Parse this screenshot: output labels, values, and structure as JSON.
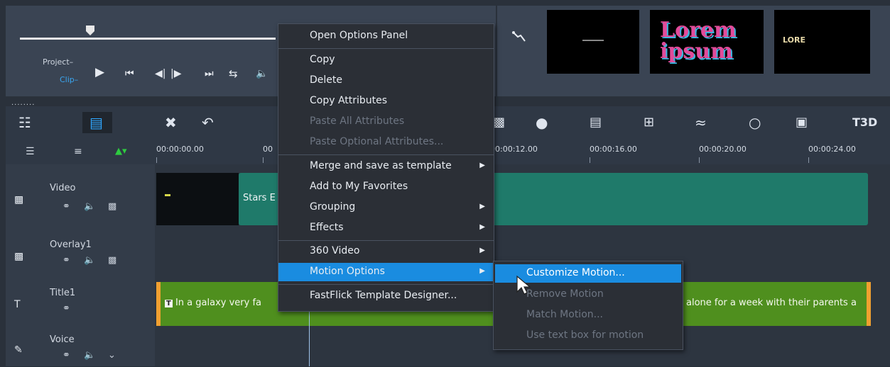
{
  "player": {
    "project_label": "Project–",
    "clip_label": "Clip–",
    "controls": [
      "▶",
      "|◀",
      "◀|",
      "|▶",
      "▶|",
      "⇄",
      "◀)"
    ]
  },
  "thumbnails": {
    "thumb2_text": "Lorem ipsum",
    "thumb3_text": "LORE"
  },
  "toolbar": {
    "dots": "........",
    "icons": [
      "film-strip-icon",
      "timeline-icon",
      "tools-icon",
      "undo-icon",
      "motion-tracking-icon",
      "mask-icon",
      "title-icon",
      "split-screen-icon",
      "speed-icon",
      "shape-icon",
      "fit-icon",
      "3d-title-icon"
    ],
    "title_3d_label": "T3D"
  },
  "ruler": {
    "ticks": [
      "00:00:00.00",
      "00",
      "00:00:12.00",
      "00:00:16.00",
      "00:00:20.00",
      "00:00:24.00"
    ]
  },
  "tracks": [
    {
      "name": "Video"
    },
    {
      "name": "Overlay1"
    },
    {
      "name": "Title1"
    },
    {
      "name": "Voice"
    }
  ],
  "clips": {
    "video_clip_label": "Stars E",
    "title_clip_left": "In a galaxy very fa",
    "title_clip_right": "alone for a week with their parents a"
  },
  "context_menu": {
    "items": [
      {
        "label": "Open Options Panel",
        "enabled": true
      },
      {
        "label": "Copy",
        "enabled": true
      },
      {
        "label": "Delete",
        "enabled": true
      },
      {
        "label": "Copy Attributes",
        "enabled": true
      },
      {
        "label": "Paste All Attributes",
        "enabled": false
      },
      {
        "label": "Paste Optional Attributes...",
        "enabled": false
      },
      {
        "label": "Merge and save as template",
        "enabled": true,
        "submenu": true
      },
      {
        "label": "Add to My Favorites",
        "enabled": true
      },
      {
        "label": "Grouping",
        "enabled": true,
        "submenu": true
      },
      {
        "label": "Effects",
        "enabled": true,
        "submenu": true
      },
      {
        "label": "360 Video",
        "enabled": true,
        "submenu": true
      },
      {
        "label": "Motion Options",
        "enabled": true,
        "submenu": true,
        "highlighted": true
      },
      {
        "label": "FastFlick Template Designer...",
        "enabled": true
      }
    ]
  },
  "motion_submenu": {
    "items": [
      {
        "label": "Customize Motion...",
        "enabled": true,
        "highlighted": true
      },
      {
        "label": "Remove Motion",
        "enabled": false
      },
      {
        "label": "Match Motion...",
        "enabled": false
      },
      {
        "label": "Use text box for motion",
        "enabled": false
      }
    ]
  },
  "colors": {
    "highlight": "#1a8ce0",
    "video_clip": "#1f7a6a",
    "title_clip": "#4f8f1e",
    "accent_green": "#2ecc40"
  }
}
